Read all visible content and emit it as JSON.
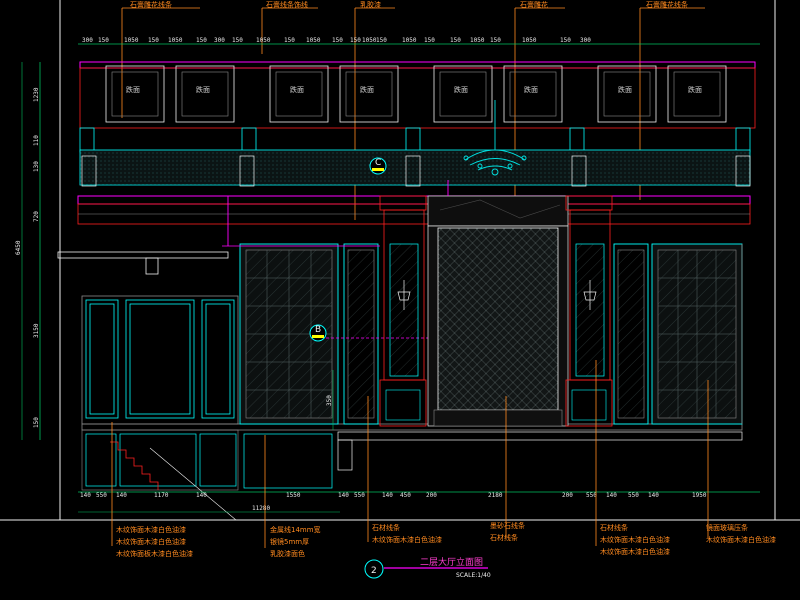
{
  "top_labels": [
    "石膏雕花线条",
    "石膏线条饰线",
    "乳胶漆",
    "石膏雕花",
    "石膏雕花线条"
  ],
  "panel_label": "跌面",
  "top_dims": [
    "300",
    "150",
    "1050",
    "150",
    "1050",
    "150",
    "300",
    "150",
    "1050",
    "150",
    "1050",
    "150",
    "150",
    "1050",
    "150",
    "1050",
    "150",
    "150",
    "1050",
    "150",
    "1050",
    "150",
    "300"
  ],
  "left_dims": [
    "1230",
    "110",
    "130",
    "720",
    "6450",
    "3150",
    "150"
  ],
  "mid_dim": "350",
  "bottom_dims": [
    "140",
    "550",
    "140",
    "1170",
    "140",
    "1550",
    "140",
    "550",
    "140",
    "450",
    "200",
    "2180",
    "200",
    "550",
    "140",
    "550",
    "140",
    "1950"
  ],
  "bottom_total": "11280",
  "markers": {
    "c": "C",
    "b": "B"
  },
  "bottom_labels": {
    "col1": [
      "木纹饰面木漆白色油漆",
      "木纹饰面木漆白色油漆",
      "木纹饰面板木漆白色油漆"
    ],
    "col2": [
      "金属线14mm宽",
      "银镜5mm厚",
      "乳胶漆面色"
    ],
    "col3": [
      "石材线条",
      "木纹饰面木漆白色油漆"
    ],
    "col4": [
      "墨砂石线条",
      "石材线条"
    ],
    "col5": [
      "石材线条",
      "木纹饰面木漆白色油漆",
      "木纹饰面木漆白色油漆"
    ],
    "col6": [
      "镜面玻璃压条",
      "木纹饰面木漆白色油漆"
    ]
  },
  "drawing_title": "二层大厅立面图",
  "scale_text": "SCALE:1/40",
  "title_number": "2",
  "colors": {
    "background": "#000000",
    "magenta": "#ff00ff",
    "cyan": "#00ffff",
    "red": "#ff2020",
    "orange": "#ff8a1f",
    "white": "#f0f0f0",
    "grey": "#8a8a8a",
    "green": "#00c060",
    "yellow": "#ffff00"
  }
}
